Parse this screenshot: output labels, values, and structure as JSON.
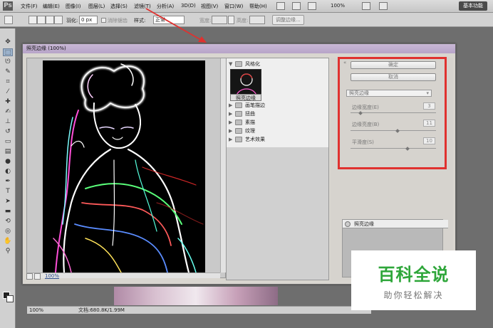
{
  "app": {
    "logo": "Ps"
  },
  "menu": [
    "文件(F)",
    "编辑(E)",
    "图像(I)",
    "图层(L)",
    "选择(S)",
    "滤镜(T)",
    "分析(A)",
    "3D(D)",
    "视图(V)",
    "窗口(W)",
    "帮助(H)"
  ],
  "menubar": {
    "zoom": "100%",
    "workspace": "基本功能"
  },
  "options": {
    "feather_label": "羽化:",
    "feather_value": "0 px",
    "antialias_label": "消除锯齿",
    "style_label": "样式:",
    "style_value": "正常",
    "width_label": "宽度:",
    "height_label": "高度:",
    "refine_edge": "调整边缘..."
  },
  "gallery": {
    "title": "照亮边缘 (100%)",
    "zoom": "100%",
    "folders": {
      "open": "风格化",
      "items": [
        "画笔描边",
        "扭曲",
        "素描",
        "纹理",
        "艺术效果"
      ]
    },
    "thumb_label": "照亮边缘",
    "ok_label": "确定",
    "cancel_label": "取消",
    "filter_select": "照亮边缘",
    "params": [
      {
        "label": "边缘宽度(E)",
        "value": "3",
        "fraction": 0.12
      },
      {
        "label": "边缘亮度(B)",
        "value": "11",
        "fraction": 0.55
      },
      {
        "label": "平滑度(S)",
        "value": "10",
        "fraction": 0.67
      }
    ],
    "layer_entry": "照亮边缘"
  },
  "status": {
    "zoom": "100%",
    "doc": "文档:680.8K/1.99M"
  },
  "watermark": {
    "title": "百科全说",
    "subtitle": "助你轻松解决"
  },
  "colors": {
    "highlight_frame": "#e0312f",
    "watermark_green": "#2ea63a"
  }
}
